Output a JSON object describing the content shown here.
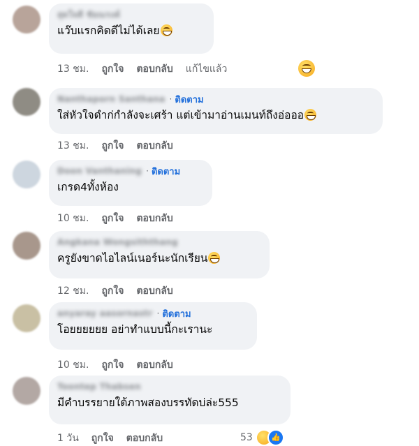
{
  "comments": [
    {
      "author": "สุดใจดี ชัยณรงค์",
      "follow": "",
      "text": "แว๊บแรกคิดดีไม่ได้เลย",
      "time": "13 ชม.",
      "like": "ถูกใจ",
      "reply": "ตอบกลับ",
      "edited": "แก้ไขแล้ว"
    },
    {
      "author": "Nanthaporn Santhana",
      "follow": "ติดตาม",
      "text": "ใส่หัวใจดำก่กำลังจะเศร้า แต่เข้ามาอ่านเมนท์ถึงอ่อออ",
      "time": "13 ชม.",
      "like": "ถูกใจ",
      "reply": "ตอบกลับ"
    },
    {
      "author": "Doon Vanthaning",
      "follow": "ติดตาม",
      "text": "เกรด4ทั้งห้อง",
      "time": "10 ชม.",
      "like": "ถูกใจ",
      "reply": "ตอบกลับ"
    },
    {
      "author": "Angkana Wongsiththang",
      "follow": "",
      "text": "ครูยังขาดไอไลน์เนอร์นะนักเรียน",
      "time": "12 ชม.",
      "like": "ถูกใจ",
      "reply": "ตอบกลับ"
    },
    {
      "author": "anyaray aasornastr",
      "follow": "ติดตาม",
      "text": "โอยยยยยย อย่าทำแบบนี้กะเรานะ",
      "time": "10 ชม.",
      "like": "ถูกใจ",
      "reply": "ตอบกลับ"
    },
    {
      "author": "Toontep Thabsen",
      "follow": "",
      "text": "มีคำบรรยายใต้ภาพสองบรรทัดบ่ล่ะ555",
      "time": "1 วัน",
      "like": "ถูกใจ",
      "reply": "ตอบกลับ",
      "reaction_count": "53"
    }
  ],
  "colors": {
    "bubble": "#f0f2f5",
    "follow": "#216fdb",
    "meta": "#65676b",
    "avatars": [
      "#b8a49a",
      "#8f8c84",
      "#cdd6df",
      "#a8978c",
      "#c9c0a4",
      "#b3a8a4"
    ]
  },
  "icons": {
    "emoji": "grinning-face-icon",
    "reaction_haha": "haha-reaction-icon",
    "reaction_like": "like-reaction-icon"
  }
}
